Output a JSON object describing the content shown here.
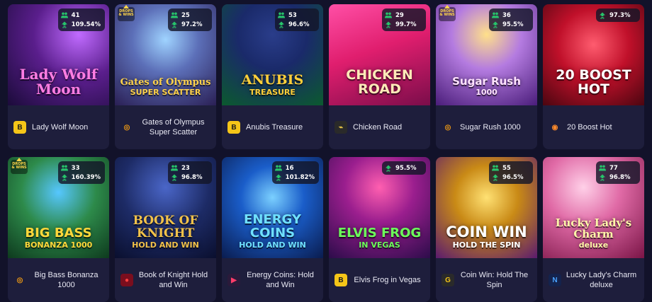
{
  "colors": {
    "background": "#12122a",
    "card": "#1e1e3c",
    "stat_green": "#27c46b"
  },
  "games": [
    {
      "name": "Lady Wolf Moon",
      "art_title": "Lady Wolf Moon",
      "players": "41",
      "rtp": "109.54%",
      "provider_icon": "bgaming-icon",
      "drops": false
    },
    {
      "name": "Gates of Olympus Super Scatter",
      "art_title": "Gates of Olympus",
      "art_sub": "SUPER SCATTER",
      "players": "25",
      "rtp": "97.2%",
      "provider_icon": "pragmatic-play-icon",
      "drops": true
    },
    {
      "name": "Anubis Treasure",
      "art_title": "ANUBIS",
      "art_sub": "TREASURE",
      "players": "53",
      "rtp": "96.6%",
      "provider_icon": "bgaming-icon",
      "drops": false
    },
    {
      "name": "Chicken Road",
      "art_title": "CHICKEN ROAD",
      "players": "29",
      "rtp": "99.7%",
      "provider_icon": "inout-icon",
      "drops": false
    },
    {
      "name": "Sugar Rush 1000",
      "art_title": "Sugar Rush",
      "art_sub": "1000",
      "players": "36",
      "rtp": "95.5%",
      "provider_icon": "pragmatic-play-icon",
      "drops": true
    },
    {
      "name": "20 Boost Hot",
      "art_title": "20 BOOST HOT",
      "rtp": "97.3%",
      "provider_icon": "endorphina-icon",
      "drops": false
    },
    {
      "name": "Big Bass Bonanza 1000",
      "art_title": "BIG BASS",
      "art_sub": "BONANZA 1000",
      "players": "33",
      "rtp": "160.39%",
      "provider_icon": "pragmatic-play-icon",
      "drops": true
    },
    {
      "name": "Book of Knight Hold and Win",
      "art_title": "BOOK OF KNIGHT",
      "art_sub": "HOLD AND WIN",
      "players": "23",
      "rtp": "96.8%",
      "provider_icon": "spinomenal-icon",
      "drops": false
    },
    {
      "name": "Energy Coins: Hold and Win",
      "art_title": "ENERGY COINS",
      "art_sub": "HOLD AND WIN",
      "players": "16",
      "rtp": "101.82%",
      "provider_icon": "play-icon",
      "drops": false
    },
    {
      "name": "Elvis Frog in Vegas",
      "art_title": "ELVIS FROG",
      "art_sub": "IN VEGAS",
      "rtp": "95.5%",
      "provider_icon": "bgaming-icon",
      "drops": false
    },
    {
      "name": "Coin Win: Hold The Spin",
      "art_title": "COIN WIN",
      "art_sub": "HOLD THE SPIN",
      "players": "55",
      "rtp": "96.5%",
      "provider_icon": "gamzix-icon",
      "drops": false
    },
    {
      "name": "Lucky Lady's Charm deluxe",
      "art_title": "Lucky Lady's Charm",
      "art_sub": "deluxe",
      "players": "77",
      "rtp": "96.8%",
      "provider_icon": "novomatic-icon",
      "drops": false
    }
  ],
  "drops_badge": {
    "line1": "DROPS",
    "line2": "& WINS"
  }
}
